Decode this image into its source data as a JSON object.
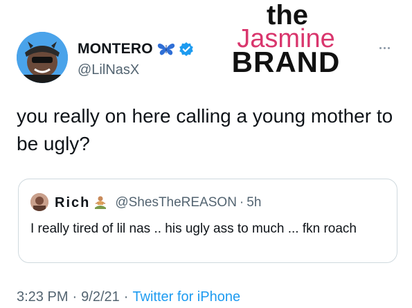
{
  "author": {
    "display_name": "MONTERO",
    "handle": "@LilNasX",
    "verified": true
  },
  "watermark": {
    "line1": "the",
    "line2": "Jasmine",
    "line3": "BRAND"
  },
  "tweet": {
    "text": "you really on here calling a young mother to be ugly?"
  },
  "quoted_tweet": {
    "display_name": "Rich",
    "handle": "@ShesTheREASON",
    "separator": "·",
    "time": "5h",
    "text": "I really tired of lil nas .. his ugly ass to much ... fkn roach"
  },
  "meta": {
    "time": "3:23 PM",
    "sep1": "·",
    "date": "9/2/21",
    "sep2": "·",
    "source": "Twitter for iPhone"
  },
  "colors": {
    "text": "#0f1419",
    "secondary": "#536471",
    "link": "#1d9bf0",
    "verified": "#1d9bf0",
    "brand_pink": "#d9366d",
    "border": "#cfd9de"
  },
  "icons": [
    "avatar",
    "butterfly-icon",
    "verified-icon",
    "more-icon",
    "person-emoji-icon"
  ]
}
